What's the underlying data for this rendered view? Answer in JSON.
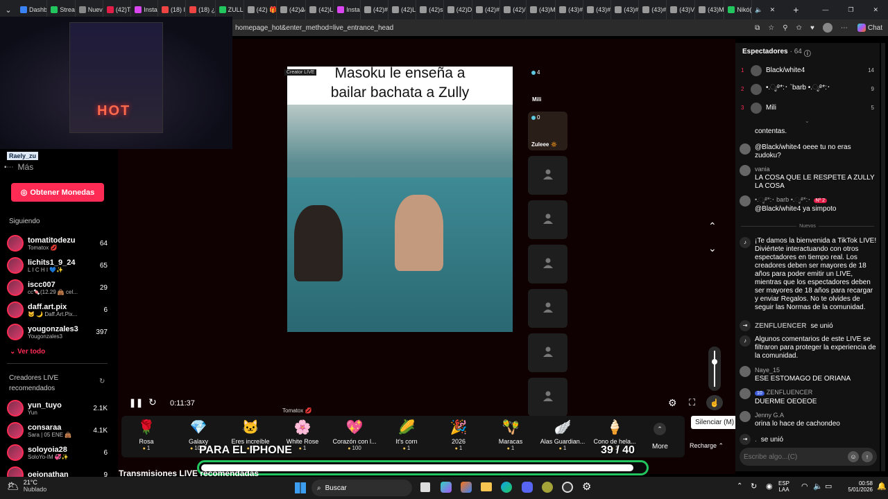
{
  "tabs": [
    {
      "label": "Dashb",
      "color": "#3b82f6"
    },
    {
      "label": "Strea",
      "color": "#22c55e"
    },
    {
      "label": "Nuev",
      "color": "#888"
    },
    {
      "label": "(42)T",
      "color": "#e11d48"
    },
    {
      "label": "Insta",
      "color": "#d946ef"
    },
    {
      "label": "(18) I",
      "color": "#ef4444"
    },
    {
      "label": "(18) ¿",
      "color": "#ef4444"
    },
    {
      "label": "ZULL",
      "color": "#22c55e"
    },
    {
      "label": "(42) 🎁",
      "color": "#999"
    },
    {
      "label": "(42)Ꮂ",
      "color": "#999"
    },
    {
      "label": "(42)L",
      "color": "#999"
    },
    {
      "label": "Insta",
      "color": "#d946ef"
    },
    {
      "label": "(42)#",
      "color": "#999"
    },
    {
      "label": "(42)L",
      "color": "#999"
    },
    {
      "label": "(42)s",
      "color": "#999"
    },
    {
      "label": "(42)D",
      "color": "#999"
    },
    {
      "label": "(42)#",
      "color": "#999"
    },
    {
      "label": "(42)/",
      "color": "#999"
    },
    {
      "label": "(43)M",
      "color": "#999"
    },
    {
      "label": "(43)#",
      "color": "#999"
    },
    {
      "label": "(43)#",
      "color": "#999"
    },
    {
      "label": "(43)#",
      "color": "#999"
    },
    {
      "label": "(43)#",
      "color": "#999"
    },
    {
      "label": "(43)V",
      "color": "#999"
    },
    {
      "label": "(43)M",
      "color": "#999"
    },
    {
      "label": "Nikó(",
      "color": "#22c55e"
    }
  ],
  "url": "homepage_hot&enter_method=live_entrance_head",
  "cam_text": "HOT",
  "streamer_tag": "Raely_zu",
  "mas": "Más",
  "coins_button": "Obtener Monedas",
  "following_title": "Siguiendo",
  "following": [
    {
      "name": "tomatitodezu",
      "sub": "Tomatox 💋",
      "count": "64"
    },
    {
      "name": "lichits1_9_24",
      "sub": "L I C H I 💙✨",
      "count": "65"
    },
    {
      "name": "iscc007",
      "sub": "cc🍬(12.29 👜 cel...",
      "count": "29"
    },
    {
      "name": "daff.art.pix",
      "sub": "🐱 🌙 Daff.Art.Pix...",
      "count": "6"
    },
    {
      "name": "yougonzales3",
      "sub": "Yougonzales3",
      "count": "397"
    }
  ],
  "ver_todo": "Ver todo",
  "recommended_title": "Creadores LIVE recomendados",
  "recommended": [
    {
      "name": "yun_tuyo",
      "sub": "Yun",
      "count": "2.1K"
    },
    {
      "name": "consaraa",
      "sub": "Sara | 05 ENE 👜",
      "count": "4.1K"
    },
    {
      "name": "soloyoia28",
      "sub": "SoloYo-IM 💞✨",
      "count": "6"
    },
    {
      "name": "oejonathan",
      "sub": "",
      "count": "9"
    }
  ],
  "video_caption": "Masoku le enseña a bailar bachata a Zully",
  "creator_badge": "Creator LIVE",
  "viewers_small": "4",
  "mili_label": "Mili",
  "guest_count": "0",
  "guest_name": "Zuleee 🔅",
  "host_label": "Tomatox 💋",
  "time": "0:11:37",
  "gifts": [
    {
      "name": "Rosa",
      "price": "1",
      "icon": "🌹"
    },
    {
      "name": "Galaxy",
      "price": "1000",
      "icon": "💎"
    },
    {
      "name": "Eres increíble",
      "price": "1",
      "icon": "🐱"
    },
    {
      "name": "White Rose",
      "price": "1",
      "icon": "🌸"
    },
    {
      "name": "Corazón con l...",
      "price": "100",
      "icon": "💖"
    },
    {
      "name": "It's corn",
      "price": "1",
      "icon": "🌽"
    },
    {
      "name": "2026",
      "price": "1",
      "icon": "🎉"
    },
    {
      "name": "Maracas",
      "price": "1",
      "icon": "🪇"
    },
    {
      "name": "Alas Guardian...",
      "price": "1",
      "icon": "🪽"
    },
    {
      "name": "Cono de hela...",
      "price": "1",
      "icon": "🍦"
    }
  ],
  "more": "More",
  "recharge": "Recharge",
  "tooltip": "Silenciar (M)",
  "goal_text": "PARA EL IPHONE",
  "goal_count": "39 / 40",
  "goal_progress": 0.975,
  "bottom_title": "Transmisiones LIVE recomendadas",
  "chat_title": "Espectadores",
  "chat_count": "· 64",
  "ranking": [
    {
      "rank": "1",
      "name": "Black/white4",
      "score": "14"
    },
    {
      "rank": "2",
      "name": "•.ೃ࿔*:･ `barb •.ೃ࿔*:･",
      "score": "9"
    },
    {
      "rank": "3",
      "name": "Mili",
      "score": "5"
    }
  ],
  "messages_top": [
    {
      "user": "",
      "text": "contentas."
    },
    {
      "user": "",
      "text": "@Black/white4 oeee tu no eras zudoku?"
    },
    {
      "user": "vania",
      "text": "LA COSA QUE LE RESPETE A ZULLY LA COSA"
    },
    {
      "user": "•.ೃ࿔*:･ barb •.ೃ࿔*:･",
      "badge": "Nº 2",
      "text": "@Black/white4 ya simpoto"
    }
  ],
  "nuevos": "Nuevos",
  "system_msg": "¡Te damos la bienvenida a TikTok LIVE! Diviértete interactuando con otros espectadores en tiempo real. Los creadores deben ser mayores de 18 años para poder emitir un LIVE, mientras que los espectadores deben ser mayores de 18 años para recargar y enviar Regalos. No te olvides de seguir las Normas de la comunidad.",
  "join1_user": "ZENFLUENCER",
  "join_text": "se unió",
  "filter_msg": "Algunos comentarios de este LIVE se filtraron para proteger la experiencia de la comunidad.",
  "messages_bottom": [
    {
      "user": "Naye_15",
      "text": "ESE ESTOMAGO DE ORIANA"
    },
    {
      "user": "ZENFLUENCER",
      "level": "10",
      "text": "DUERME OEOEOE"
    },
    {
      "user": "Jenny G.A",
      "text": "orina lo hace de cachondeo"
    }
  ],
  "join2_user": ".",
  "input_placeholder": "Escribe algo...(C)",
  "weather_temp": "21°C",
  "weather_desc": "Nublado",
  "search_label": "Buscar",
  "lang1": "ESP",
  "lang2": "LAA",
  "clock_time": "00:58",
  "clock_date": "5/01/2026"
}
